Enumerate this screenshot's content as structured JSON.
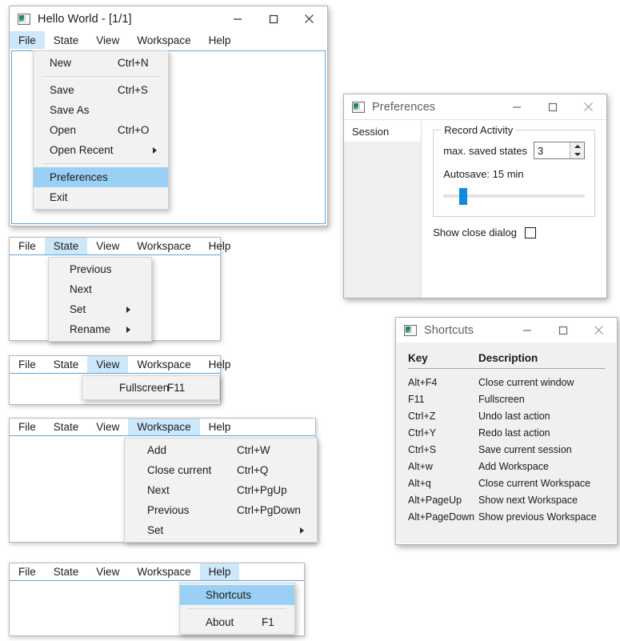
{
  "main_window": {
    "title": "Hello World - [1/1]",
    "icon": "app-window-icon",
    "controls": {
      "minimize": "minimize-icon",
      "maximize": "maximize-icon",
      "close": "close-icon"
    },
    "menubar": [
      "File",
      "State",
      "View",
      "Workspace",
      "Help"
    ],
    "active_menu": "File",
    "file_menu": {
      "items": [
        {
          "label": "New",
          "accel": "Ctrl+N",
          "selected": false,
          "submenu": false
        },
        {
          "label": "Save",
          "accel": "Ctrl+S",
          "selected": false,
          "submenu": false
        },
        {
          "label": "Save As",
          "accel": "",
          "selected": false,
          "submenu": false
        },
        {
          "label": "Open",
          "accel": "Ctrl+O",
          "selected": false,
          "submenu": false
        },
        {
          "label": "Open Recent",
          "accel": "",
          "selected": false,
          "submenu": true
        },
        {
          "label": "Preferences",
          "accel": "",
          "selected": true,
          "submenu": false
        },
        {
          "label": "Exit",
          "accel": "",
          "selected": false,
          "submenu": false
        }
      ]
    }
  },
  "preferences_window": {
    "title": "Preferences",
    "icon": "app-window-icon",
    "controls": {
      "minimize": "minimize-icon",
      "maximize": "maximize-icon",
      "close": "close-icon"
    },
    "nav": [
      "Session"
    ],
    "group_title": "Record Activity",
    "max_saved_states_label": "max. saved states",
    "max_saved_states_value": "3",
    "autosave_label": "Autosave: 15 min",
    "autosave_minutes": 15,
    "slider_position_pct": 12,
    "show_close_dialog_label": "Show close dialog",
    "show_close_dialog_checked": false
  },
  "shortcuts_window": {
    "title": "Shortcuts",
    "icon": "app-window-icon",
    "controls": {
      "minimize": "minimize-icon",
      "maximize": "maximize-icon",
      "close": "close-icon"
    },
    "columns": [
      "Key",
      "Description"
    ],
    "rows": [
      {
        "key": "Alt+F4",
        "desc": "Close current window"
      },
      {
        "key": "F11",
        "desc": "Fullscreen"
      },
      {
        "key": "Ctrl+Z",
        "desc": "Undo last action"
      },
      {
        "key": "Ctrl+Y",
        "desc": "Redo last action"
      },
      {
        "key": "Ctrl+S",
        "desc": "Save current session"
      },
      {
        "key": "Alt+w",
        "desc": "Add Workspace"
      },
      {
        "key": "Alt+q",
        "desc": "Close current Workspace"
      },
      {
        "key": "Alt+PageUp",
        "desc": "Show next Workspace"
      },
      {
        "key": "Alt+PageDown",
        "desc": "Show previous Workspace"
      }
    ]
  },
  "state_demo": {
    "menubar": [
      "File",
      "State",
      "View",
      "Workspace",
      "Help"
    ],
    "active_menu": "State",
    "items": [
      {
        "label": "Previous",
        "accel": "",
        "selected": false,
        "submenu": false
      },
      {
        "label": "Next",
        "accel": "",
        "selected": false,
        "submenu": false
      },
      {
        "label": "Set",
        "accel": "",
        "selected": false,
        "submenu": true
      },
      {
        "label": "Rename",
        "accel": "",
        "selected": false,
        "submenu": true
      }
    ]
  },
  "view_demo": {
    "menubar": [
      "File",
      "State",
      "View",
      "Workspace",
      "Help"
    ],
    "active_menu": "View",
    "items": [
      {
        "label": "Fullscreen",
        "accel": "F11",
        "selected": false,
        "submenu": false
      }
    ]
  },
  "workspace_demo": {
    "menubar": [
      "File",
      "State",
      "View",
      "Workspace",
      "Help"
    ],
    "active_menu": "Workspace",
    "items": [
      {
        "label": "Add",
        "accel": "Ctrl+W",
        "selected": false,
        "submenu": false
      },
      {
        "label": "Close current",
        "accel": "Ctrl+Q",
        "selected": false,
        "submenu": false
      },
      {
        "label": "Next",
        "accel": "Ctrl+PgUp",
        "selected": false,
        "submenu": false
      },
      {
        "label": "Previous",
        "accel": "Ctrl+PgDown",
        "selected": false,
        "submenu": false
      },
      {
        "label": "Set",
        "accel": "",
        "selected": false,
        "submenu": true
      }
    ]
  },
  "help_demo": {
    "menubar": [
      "File",
      "State",
      "View",
      "Workspace",
      "Help"
    ],
    "active_menu": "Help",
    "items": [
      {
        "label": "Shortcuts",
        "accel": "",
        "selected": true,
        "submenu": false
      },
      {
        "label": "About",
        "accel": "F1",
        "selected": false,
        "submenu": false
      }
    ]
  },
  "colors": {
    "menu_highlight": "#9ad0f5",
    "menubar_active": "#cde8fb",
    "accent_blue": "#0a8ae0",
    "canvas_border": "#5ba7e3",
    "popup_bg": "#f2f2f2"
  }
}
